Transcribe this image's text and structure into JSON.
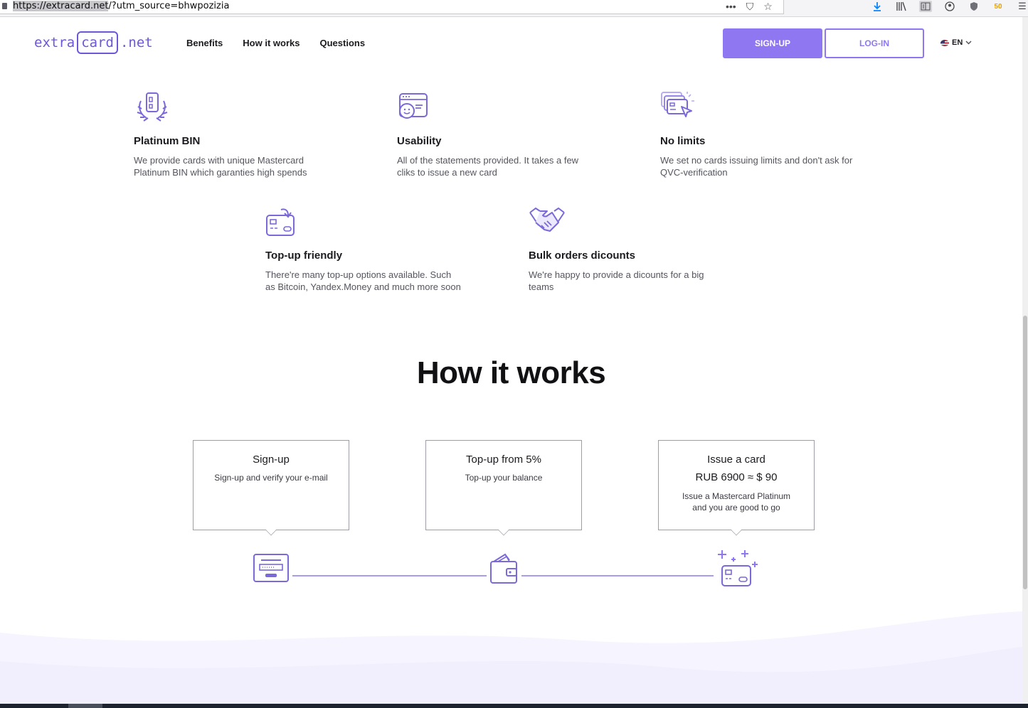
{
  "browser": {
    "url_host": "https://extracard.net",
    "url_rest": "/?utm_source=bhwpozizia",
    "more_glyph": "•••",
    "pocket_glyph": "⛉",
    "star_glyph": "☆",
    "menu_glyph": "☰",
    "badge_text": "50",
    "icons": [
      "download-icon",
      "library-icon",
      "reader-view-icon",
      "account-icon",
      "shield-icon",
      "extension-badge-icon",
      "menu-icon"
    ]
  },
  "header": {
    "logo_left": "extra",
    "logo_box": "card",
    "logo_right": ".net",
    "nav": [
      "Benefits",
      "How it works",
      "Questions"
    ],
    "signup_label": "SIGN-UP",
    "login_label": "LOG-IN",
    "lang_label": "EN",
    "accent_color": "#8f77f2"
  },
  "benefits": [
    {
      "icon": "laurel-card-icon",
      "title": "Platinum BIN",
      "text_1": "We provide cards with unique Mastercard",
      "text_2": "Platinum BIN which garanties high spends"
    },
    {
      "icon": "smiley-window-icon",
      "title": "Usability",
      "text_1": "All of the statements provided. It takes a few",
      "text_2": "cliks to issue a new card"
    },
    {
      "icon": "cards-cursor-icon",
      "title": "No limits",
      "text_1": "We set no cards issuing limits and don't ask for",
      "text_2": "QVC-verification"
    },
    {
      "icon": "card-topup-icon",
      "title": "Top-up friendly",
      "text_1": "There're many top-up options available. Such",
      "text_2": "as Bitcoin, Yandex.Money and much more soon"
    },
    {
      "icon": "handshake-icon",
      "title": "Bulk orders dicounts",
      "text_1": "We're happy to provide a dicounts for a big",
      "text_2": "teams"
    }
  ],
  "how": {
    "title": "How it works",
    "steps": [
      {
        "title": "Sign-up",
        "text": "Sign-up and verify your e-mail"
      },
      {
        "title": "Top-up from 5%",
        "text": "Top-up your balance"
      },
      {
        "title": "Issue a card",
        "price": "RUB 6900 ≈ $ 90",
        "text_1": "Issue a Mastercard Platinum",
        "text_2": "and you are good to go"
      }
    ]
  }
}
